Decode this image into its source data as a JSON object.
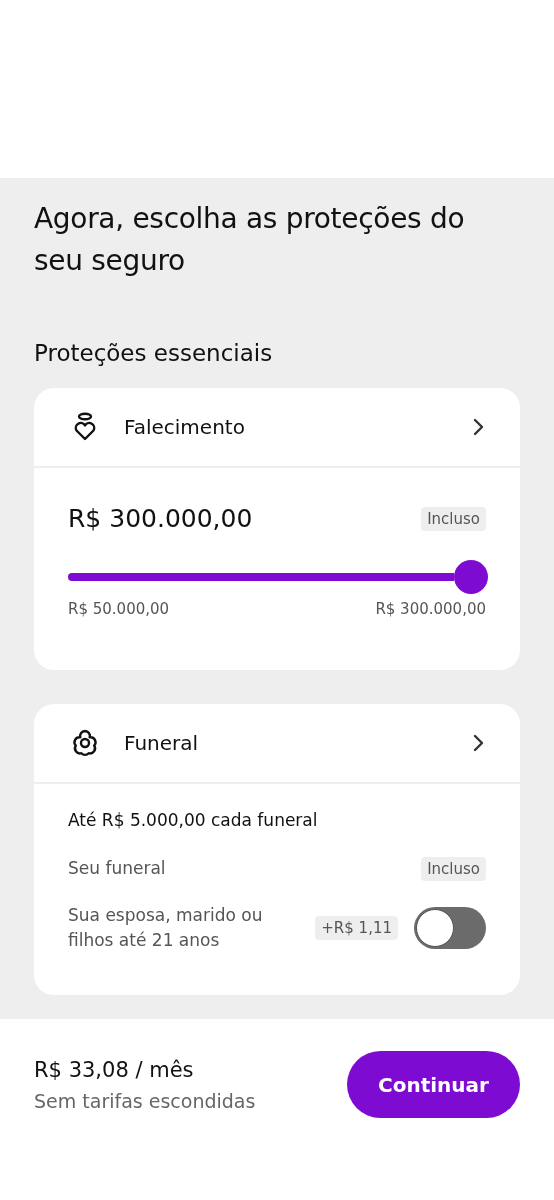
{
  "title": "Agora, escolha as proteções do seu seguro",
  "section_title": "Proteções essenciais",
  "cards": [
    {
      "kind": "slider",
      "title": "Falecimento",
      "amount": "R$ 300.000,00",
      "badge": "Incluso",
      "slider": {
        "level": 1,
        "min_label": "R$ 50.000,00",
        "max_label": "R$ 300.000,00"
      }
    },
    {
      "kind": "list",
      "title": "Funeral",
      "subtitle": "Até R$ 5.000,00 cada funeral",
      "rows": [
        {
          "kind": "badge",
          "label": "Seu funeral",
          "badge": "Incluso"
        },
        {
          "kind": "toggle",
          "label": "Sua esposa, marido ou filhos até 21 anos",
          "badge": "+R$ 1,11",
          "on": false
        }
      ]
    }
  ],
  "footer": {
    "price": "R$ 33,08 / mês",
    "note": "Sem tarifas escondidas",
    "button": "Continuar"
  }
}
